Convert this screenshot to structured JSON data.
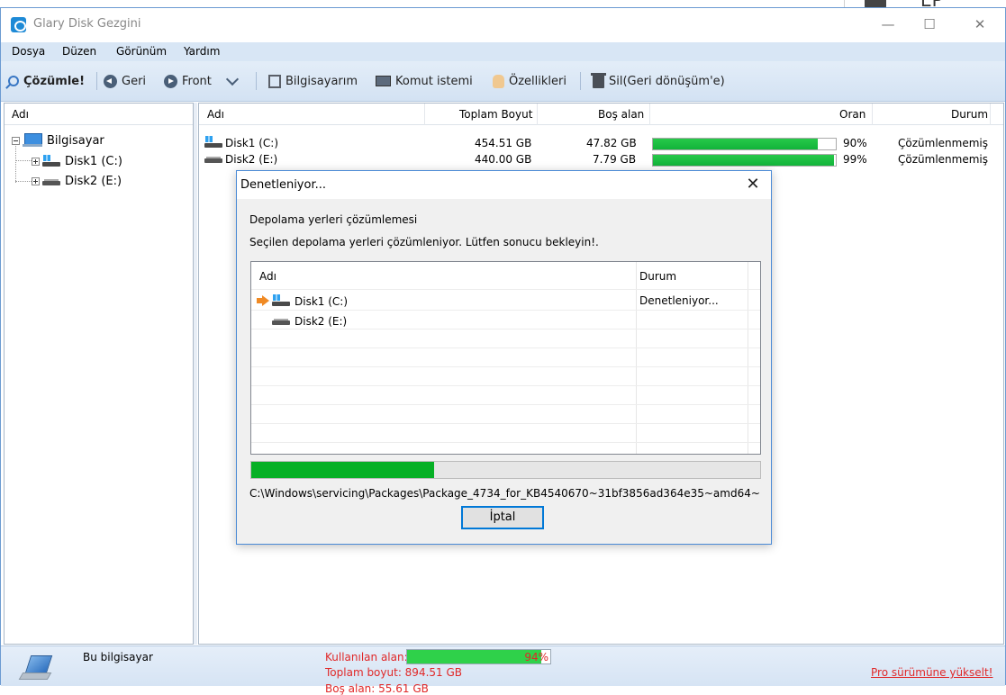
{
  "window": {
    "title": "Glary Disk Gezgini",
    "controls": {
      "minimize": "—",
      "maximize": "☐",
      "close": "✕"
    }
  },
  "background_fragment": "EP",
  "menu": [
    "Dosya",
    "Düzen",
    "Görünüm",
    "Yardım"
  ],
  "toolbar": {
    "analyze": "Çözümle!",
    "back": "Geri",
    "forward": "Front",
    "my_computer": "Bilgisayarım",
    "command_prompt": "Komut istemi",
    "properties": "Özellikleri",
    "recycle": "Sil(Geri dönüşüm'e)"
  },
  "tree": {
    "header": "Adı",
    "root": "Bilgisayar",
    "children": [
      "Disk1 (C:)",
      "Disk2 (E:)"
    ]
  },
  "drives_table": {
    "headers": {
      "name": "Adı",
      "total": "Toplam Boyut",
      "free": "Boş alan",
      "ratio": "Oran",
      "status": "Durum"
    },
    "rows": [
      {
        "name": "Disk1 (C:)",
        "total": "454.51 GB",
        "free": "47.82 GB",
        "ratio": "90%",
        "ratio_value": 0.9,
        "status": "Çözümlenmemiş"
      },
      {
        "name": "Disk2 (E:)",
        "total": "440.00 GB",
        "free": "7.79 GB",
        "ratio": "99%",
        "ratio_value": 0.99,
        "status": "Çözümlenmemiş"
      }
    ]
  },
  "dialog": {
    "title": "Denetleniyor...",
    "close": "✕",
    "heading": "Depolama yerleri çözümlemesi",
    "message": "Seçilen depolama yerleri çözümleniyor. Lütfen sonucu bekleyin!.",
    "list_headers": {
      "name": "Adı",
      "status": "Durum"
    },
    "items": [
      {
        "name": "Disk1 (C:)",
        "status": "Denetleniyor..."
      },
      {
        "name": "Disk2 (E:)",
        "status": ""
      }
    ],
    "progress": 0.36,
    "current_path": "C:\\Windows\\servicing\\Packages\\Package_4734_for_KB4540670~31bf3856ad364e35~amd64~",
    "cancel": "İptal"
  },
  "statusbar": {
    "computer_name": "Bu bilgisayar",
    "used_label": "Kullanılan alan:",
    "used_percent": "94%",
    "used_value": 0.94,
    "total": "Toplam boyut: 894.51 GB",
    "free": "Boş alan: 55.61 GB",
    "upgrade": "Pro sürümüne yükselt!"
  },
  "colors": {
    "accent": "#0078d7",
    "progress_green": "#06b025",
    "status_red": "#e02828",
    "menubar": "#d8e6f5"
  }
}
